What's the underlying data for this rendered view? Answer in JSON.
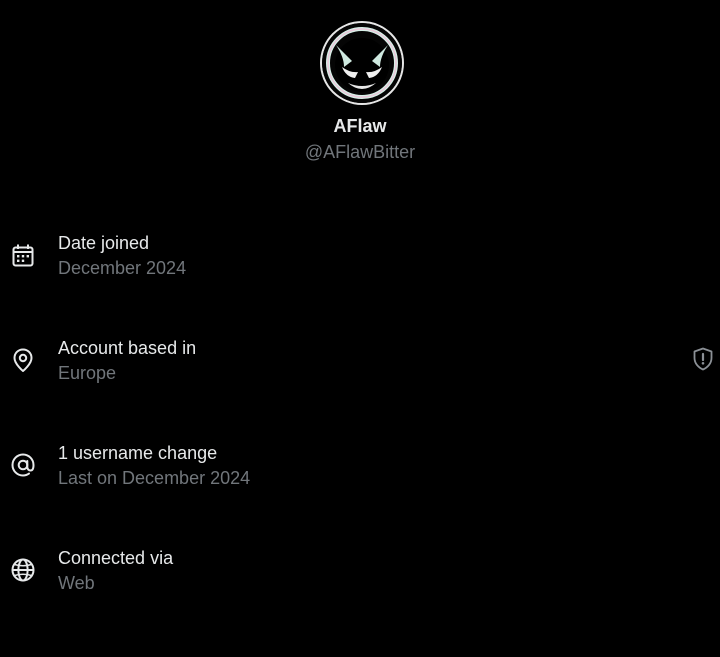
{
  "profile": {
    "display_name": "AFlaw",
    "handle": "@AFlawBitter"
  },
  "about": {
    "date_joined": {
      "icon": "calendar-icon",
      "title": "Date joined",
      "value": "December 2024"
    },
    "account_based_in": {
      "icon": "location-pin-icon",
      "title": "Account based in",
      "value": "Europe",
      "trailing_icon": "shield-alert-icon"
    },
    "username_changes": {
      "icon": "at-sign-icon",
      "title": "1 username change",
      "value": "Last on December 2024"
    },
    "connected_via": {
      "icon": "globe-icon",
      "title": "Connected via",
      "value": "Web"
    }
  },
  "colors": {
    "background": "#000000",
    "primary_text": "#e7e9ea",
    "secondary_text": "#71767b"
  }
}
